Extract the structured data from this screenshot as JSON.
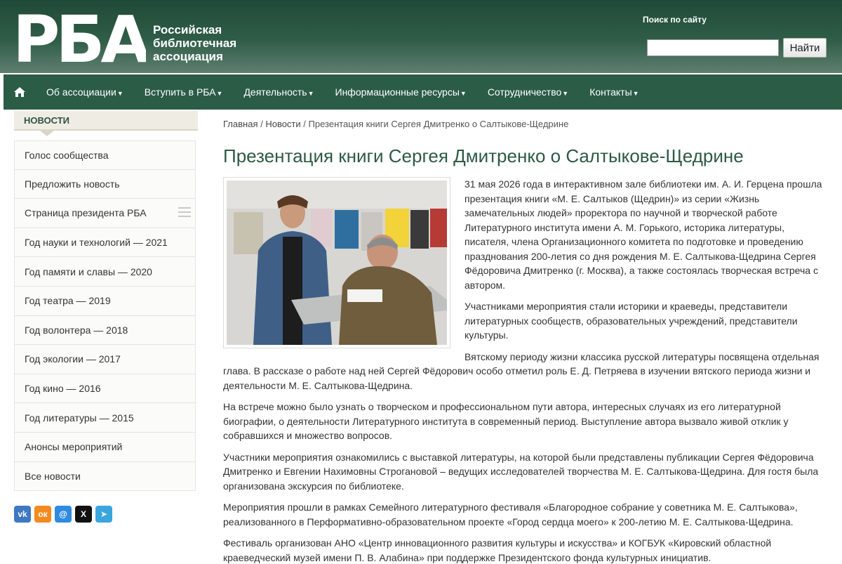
{
  "header": {
    "logo_big": "РБА",
    "logo_line1": "Российская",
    "logo_line2": "библиотечная",
    "logo_line3": "ассоциация",
    "search_label": "Поиск по сайту",
    "search_value": "",
    "search_button": "Найти"
  },
  "nav": {
    "items": [
      {
        "label": "Об ассоциации"
      },
      {
        "label": "Вступить в РБА"
      },
      {
        "label": "Деятельность"
      },
      {
        "label": "Информационные ресурсы"
      },
      {
        "label": "Сотрудничество"
      },
      {
        "label": "Контакты"
      }
    ]
  },
  "sidebar": {
    "heading": "НОВОСТИ",
    "items": [
      {
        "label": "Голос сообщества"
      },
      {
        "label": "Предложить новость"
      },
      {
        "label": "Страница президента РБА"
      },
      {
        "label": "Год науки и технологий — 2021"
      },
      {
        "label": "Год памяти и славы — 2020"
      },
      {
        "label": "Год театра — 2019"
      },
      {
        "label": "Год волонтера — 2018"
      },
      {
        "label": "Год экологии — 2017"
      },
      {
        "label": "Год кино — 2016"
      },
      {
        "label": "Год литературы — 2015"
      },
      {
        "label": "Анонсы мероприятий"
      },
      {
        "label": "Все новости"
      }
    ],
    "social": [
      {
        "icon": "vk-icon",
        "glyph": "vk",
        "color": "#3f78c2"
      },
      {
        "icon": "odnoklassniki-icon",
        "glyph": "ок",
        "color": "#f48a1e"
      },
      {
        "icon": "moimir-icon",
        "glyph": "@",
        "color": "#2f8be0"
      },
      {
        "icon": "x-icon",
        "glyph": "X",
        "color": "#111111"
      },
      {
        "icon": "telegram-icon",
        "glyph": "➤",
        "color": "#3aa6de"
      }
    ]
  },
  "breadcrumb": {
    "home": "Главная",
    "section": "Новости",
    "current": "Презентация книги Сергея Дмитренко о Салтыкове-Щедрине",
    "sep": " / "
  },
  "article": {
    "title": "Презентация книги Сергея Дмитренко о Салтыкове-Щедрине",
    "paragraphs": [
      "31 мая 2026 года в интерактивном зале библиотеки им. А. И. Герцена прошла презентация книги «М. Е. Салтыков (Щедрин)» из серии «Жизнь замечательных людей» проректора по научной и творческой работе Литературного института имени А. М. Горького, историка литературы, писателя, члена Организационного комитета по подготовке и проведению празднования 200-летия со дня рождения М. Е. Салтыкова-Щедрина Сергея Фёдоровича Дмитренко (г. Москва), а также состоялась творческая встреча с автором.",
      "Участниками мероприятия стали историки и краеведы, представители литературных сообществ, образовательных учреждений, представители культуры.",
      "Вятскому периоду жизни классика русской литературы посвящена отдельная глава. В рассказе о работе над ней Сергей Фёдорович особо отметил роль Е. Д. Петряева в изучении вятского периода жизни и деятельности М. Е. Салтыкова-Щедрина.",
      "На встрече можно было узнать о творческом и профессиональном пути автора, интересных случаях из его литературной биографии, о деятельности Литературного института в современный период. Выступление автора вызвало живой отклик у собравшихся и множество вопросов.",
      "Участники мероприятия ознакомились с выставкой литературы, на которой были представлены публикации Сергея Фёдоровича Дмитренко и Евгении Нахимовны Строгановой – ведущих исследователей творчества М. Е. Салтыкова-Щедрина. Для гостя была организована экскурсия по библиотеке.",
      "Мероприятия прошли в рамках Семейного литературного фестиваля «Благородное собрание у советника М. Е. Салтыкова», реализованного в Перформативно-образовательном проекте «Город сердца моего» к 200-летию М. Е. Салтыкова-Щедрина.",
      "Фестиваль организован АНО «Центр инновационного развития культуры и искусства» и КОГБУК «Кировский областной краеведческий музей имени П. В. Алабина» при поддержке Президентского фонда культурных инициатив."
    ]
  }
}
